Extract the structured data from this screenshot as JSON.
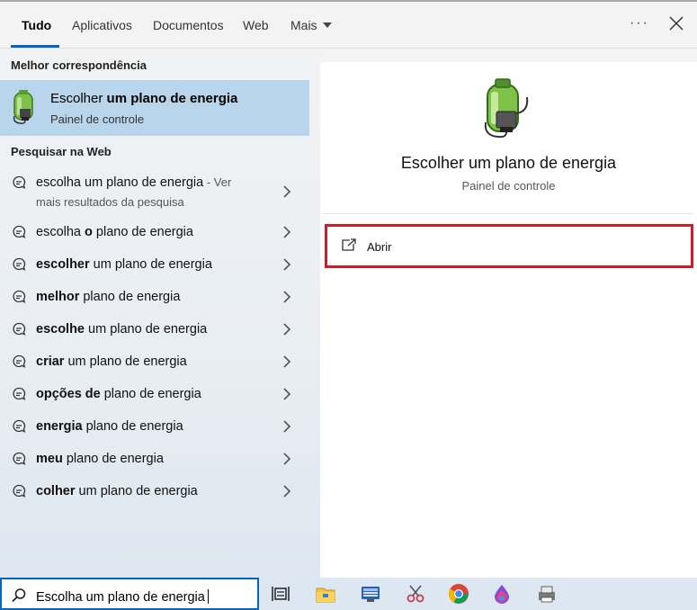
{
  "tabs": [
    {
      "label": "Tudo",
      "active": true
    },
    {
      "label": "Aplicativos",
      "active": false
    },
    {
      "label": "Documentos",
      "active": false
    },
    {
      "label": "Web",
      "active": false
    },
    {
      "label": "Mais",
      "active": false
    }
  ],
  "header": {
    "more_options": "···"
  },
  "left": {
    "best_match_title": "Melhor correspondência",
    "best_match": {
      "title_plain": "Escolher ",
      "title_bold": "um plano de energia",
      "subtitle": "Painel de controle",
      "icon": "battery-plug-icon"
    },
    "web_title": "Pesquisar na Web",
    "web_results": [
      {
        "pre": "escolha um plano de energia",
        "bold": "",
        "post": "",
        "extra": " - Ver",
        "line2": "mais resultados da pesquisa"
      },
      {
        "pre": "escolha ",
        "bold": "o",
        "post": " plano de energia"
      },
      {
        "pre": "",
        "bold": "escolher",
        "post": " um plano de energia"
      },
      {
        "pre": "",
        "bold": "melhor",
        "post": " plano de energia"
      },
      {
        "pre": "",
        "bold": "escolhe",
        "post": " um plano de energia"
      },
      {
        "pre": "",
        "bold": "criar",
        "post": " um plano de energia"
      },
      {
        "pre": "",
        "bold": "opções de",
        "post": " plano de energia"
      },
      {
        "pre": "",
        "bold": "energia",
        "post": " plano de energia"
      },
      {
        "pre": "",
        "bold": "meu",
        "post": " plano de energia"
      },
      {
        "pre": "",
        "bold": "colher",
        "post": " um plano de energia"
      }
    ]
  },
  "right": {
    "title": "Escolher um plano de energia",
    "subtitle": "Painel de controle",
    "open_label": "Abrir"
  },
  "taskbar": {
    "search_value": "Escolha um plano de energia",
    "icons": [
      "task-view-icon",
      "file-explorer-icon",
      "network-app-icon",
      "snipping-tool-icon",
      "chrome-icon",
      "paint-icon",
      "printer-app-icon"
    ]
  },
  "colors": {
    "accent": "#0067c0",
    "selection": "#b9d5ec",
    "highlight_border": "#d11a2a"
  }
}
